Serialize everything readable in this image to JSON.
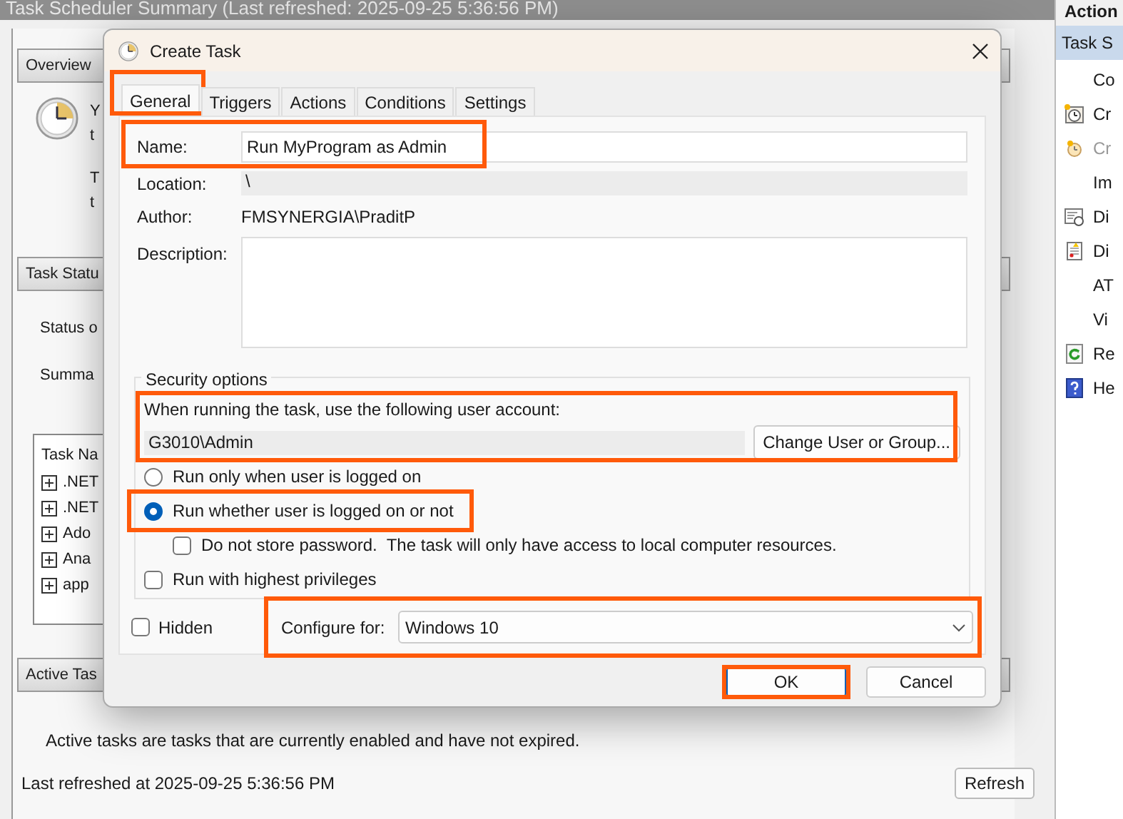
{
  "main_window": {
    "header": "Task Scheduler Summary (Last refreshed: 2025-09-25 5:36:56 PM)",
    "overview": {
      "title": "Overview",
      "lines": [
        "Y",
        "t",
        "T",
        "t"
      ]
    },
    "task_status": {
      "title": "Task Statu",
      "labels": [
        "Status o",
        "Summa"
      ],
      "list_header": "Task Na",
      "rows": [
        ".NET",
        ".NET",
        "Ado",
        "Ana",
        "app"
      ]
    },
    "active_tasks": {
      "title": "Active Tas",
      "text": "Active tasks are tasks that are currently enabled and have not expired."
    },
    "footer": {
      "text": "Last refreshed at 2025-09-25 5:36:56 PM",
      "button": "Refresh"
    }
  },
  "actions_pane": {
    "title": "Action",
    "group": "Task S",
    "items": [
      {
        "label": "Co",
        "disabled": false
      },
      {
        "label": "Cr",
        "disabled": false
      },
      {
        "label": "Cr",
        "disabled": true
      },
      {
        "label": "Im",
        "disabled": false
      },
      {
        "label": "Di",
        "disabled": false
      },
      {
        "label": "Di",
        "disabled": false
      },
      {
        "label": "AT",
        "disabled": false
      },
      {
        "label": "Vi",
        "disabled": false
      },
      {
        "label": "Re",
        "disabled": false
      },
      {
        "label": "He",
        "disabled": false
      }
    ]
  },
  "dialog": {
    "title": "Create Task",
    "tabs": [
      {
        "label": "General",
        "selected": true,
        "highlighted": true
      },
      {
        "label": "Triggers",
        "selected": false,
        "highlighted": false
      },
      {
        "label": "Actions",
        "selected": false,
        "highlighted": false
      },
      {
        "label": "Conditions",
        "selected": false,
        "highlighted": false
      },
      {
        "label": "Settings",
        "selected": false,
        "highlighted": false
      }
    ],
    "name": {
      "label": "Name:",
      "value": "Run MyProgram as Admin",
      "highlighted": true
    },
    "location": {
      "label": "Location:",
      "value": "\\"
    },
    "author": {
      "label": "Author:",
      "value": "FMSYNERGIA\\PraditP"
    },
    "description": {
      "label": "Description:"
    },
    "security": {
      "title": "Security options",
      "account_label": "When running the task, use the following user account:",
      "account": "G3010\\Admin",
      "change_button": "Change User or Group...",
      "highlighted": true,
      "options": [
        {
          "kind": "radio",
          "label": "Run only when user is logged on",
          "selected": false,
          "highlighted": false
        },
        {
          "kind": "radio",
          "label": "Run whether user is logged on or not",
          "selected": true,
          "highlighted": true
        },
        {
          "kind": "checkbox",
          "label": "Do not store password.  The task will only have access to local computer resources.",
          "checked": false,
          "highlighted": false
        },
        {
          "kind": "checkbox",
          "label": "Run with highest privileges",
          "checked": false,
          "highlighted": false
        }
      ]
    },
    "hidden": {
      "label": "Hidden",
      "checked": false
    },
    "configure_for": {
      "label": "Configure for:",
      "value": "Windows 10",
      "highlighted": true
    },
    "buttons": [
      {
        "label": "OK",
        "highlighted": true
      },
      {
        "label": "Cancel",
        "highlighted": false
      }
    ]
  }
}
